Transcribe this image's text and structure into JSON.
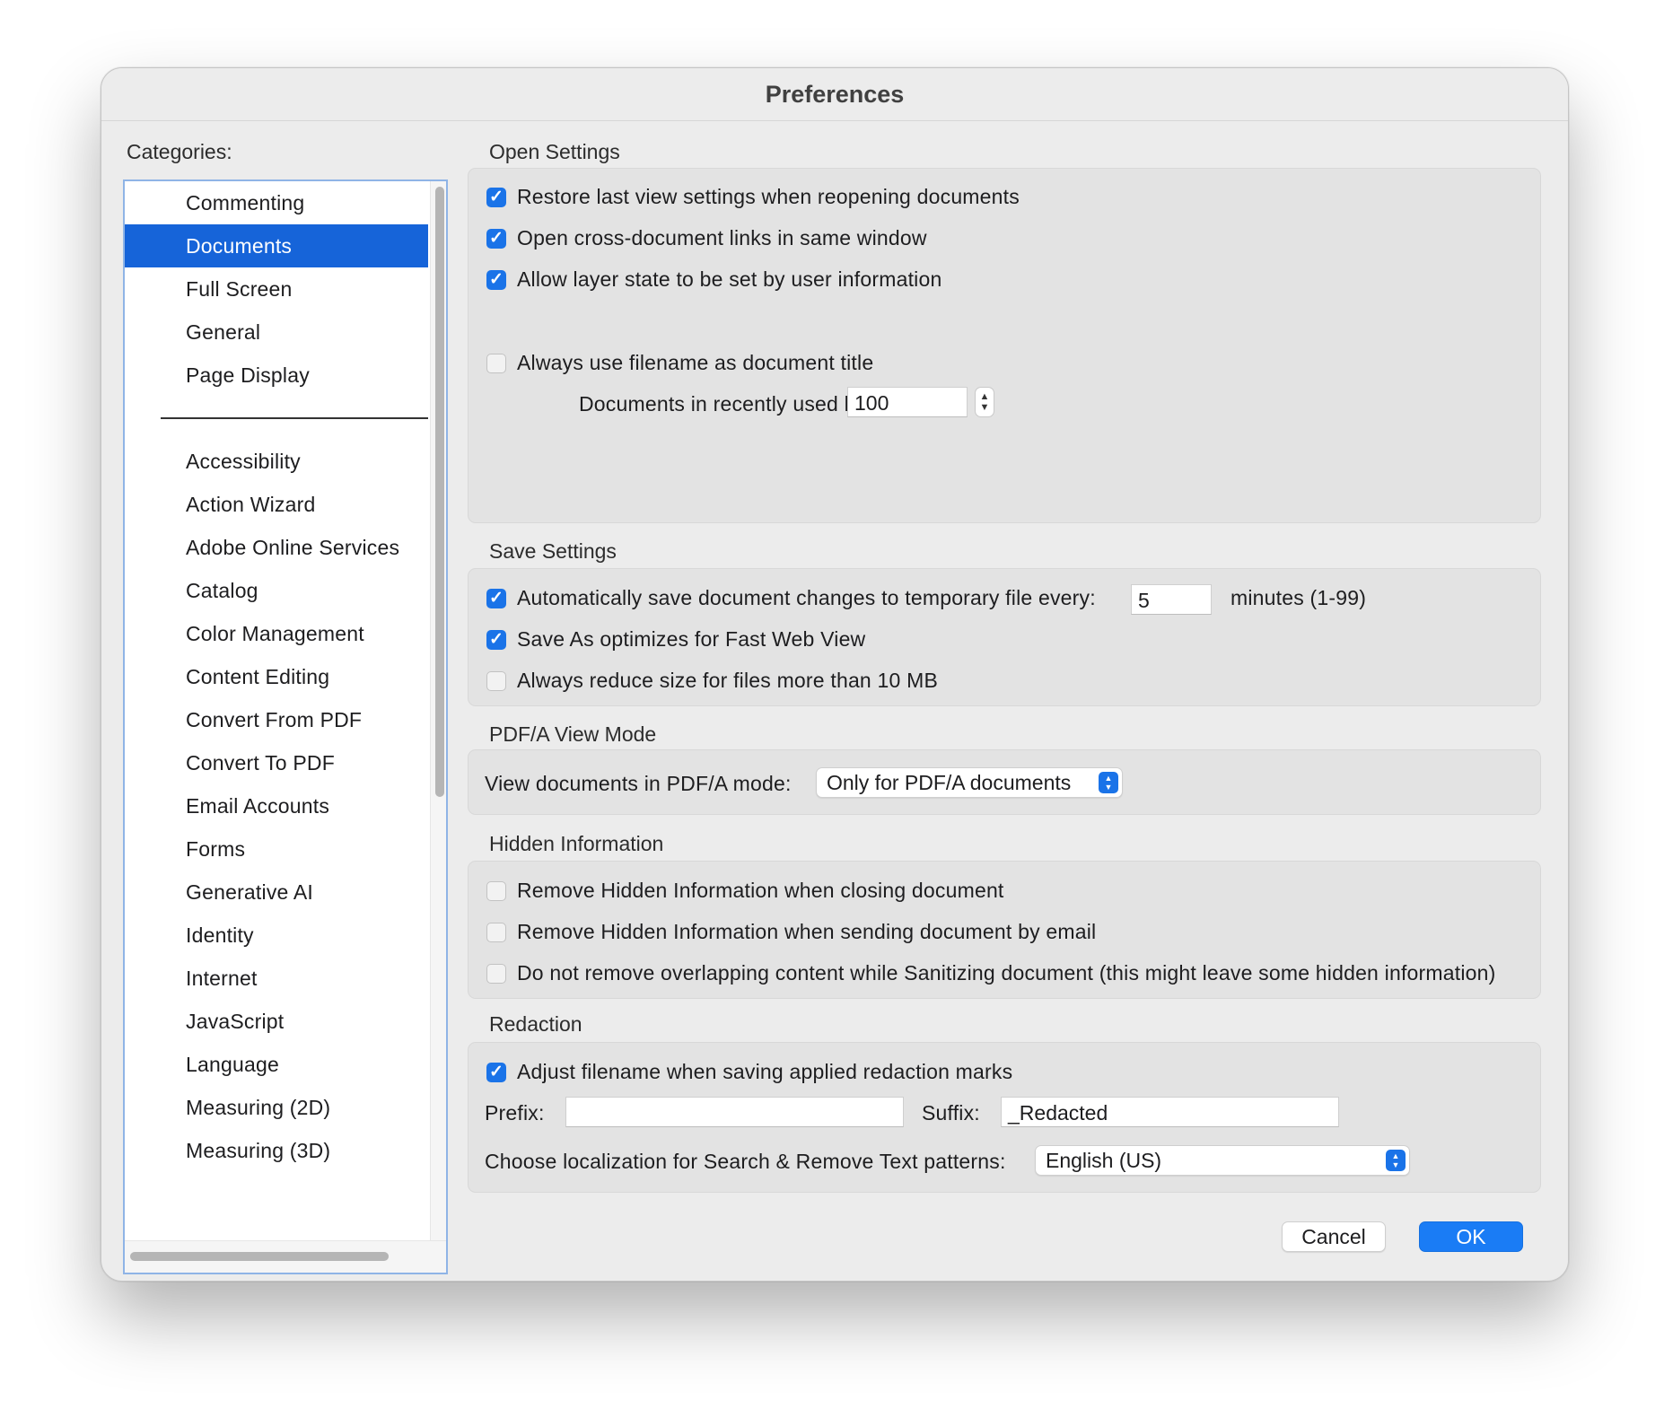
{
  "window": {
    "title": "Preferences"
  },
  "categories": {
    "label": "Categories:",
    "top_items": [
      "Commenting",
      "Documents",
      "Full Screen",
      "General",
      "Page Display"
    ],
    "items": [
      "Accessibility",
      "Action Wizard",
      "Adobe Online Services",
      "Catalog",
      "Color Management",
      "Content Editing",
      "Convert From PDF",
      "Convert To PDF",
      "Email Accounts",
      "Forms",
      "Generative AI",
      "Identity",
      "Internet",
      "JavaScript",
      "Language",
      "Measuring (2D)",
      "Measuring (3D)"
    ],
    "selected": "Documents"
  },
  "open_settings": {
    "title": "Open Settings",
    "restore_last_view": {
      "label": "Restore last view settings when reopening documents",
      "checked": true
    },
    "cross_doc_links": {
      "label": "Open cross-document links in same window",
      "checked": true
    },
    "layer_state": {
      "label": "Allow layer state to be set by user information",
      "checked": true
    },
    "filename_title": {
      "label": "Always use filename as document title",
      "checked": false
    },
    "recent_list_label": "Documents in recently used list:",
    "recent_list_value": "100"
  },
  "save_settings": {
    "title": "Save Settings",
    "autosave": {
      "label": "Automatically save document changes to temporary file every:",
      "checked": true
    },
    "autosave_minutes": "5",
    "autosave_units": "minutes (1-99)",
    "fast_web_view": {
      "label": "Save As optimizes for Fast Web View",
      "checked": true
    },
    "reduce_size": {
      "label": "Always reduce size for files more than 10 MB",
      "checked": false
    }
  },
  "pdfa": {
    "title": "PDF/A View Mode",
    "label": "View documents in PDF/A mode:",
    "selected": "Only for PDF/A documents"
  },
  "hidden_info": {
    "title": "Hidden Information",
    "on_close": {
      "label": "Remove Hidden Information when closing document",
      "checked": false
    },
    "on_email": {
      "label": "Remove Hidden Information when sending document by email",
      "checked": false
    },
    "overlapping": {
      "label": "Do not remove overlapping content while Sanitizing document (this might leave some hidden information)",
      "checked": false
    }
  },
  "redaction": {
    "title": "Redaction",
    "adjust_filename": {
      "label": "Adjust filename when saving applied redaction marks",
      "checked": true
    },
    "prefix_label": "Prefix:",
    "prefix_value": "",
    "suffix_label": "Suffix:",
    "suffix_value": "_Redacted",
    "localization_label": "Choose localization for Search & Remove Text patterns:",
    "localization_value": "English (US)"
  },
  "buttons": {
    "cancel": "Cancel",
    "ok": "OK"
  },
  "colors": {
    "accent": "#1a73e8",
    "selection": "#1664d9",
    "window_bg": "#ececec",
    "group_bg": "#e3e3e3"
  }
}
